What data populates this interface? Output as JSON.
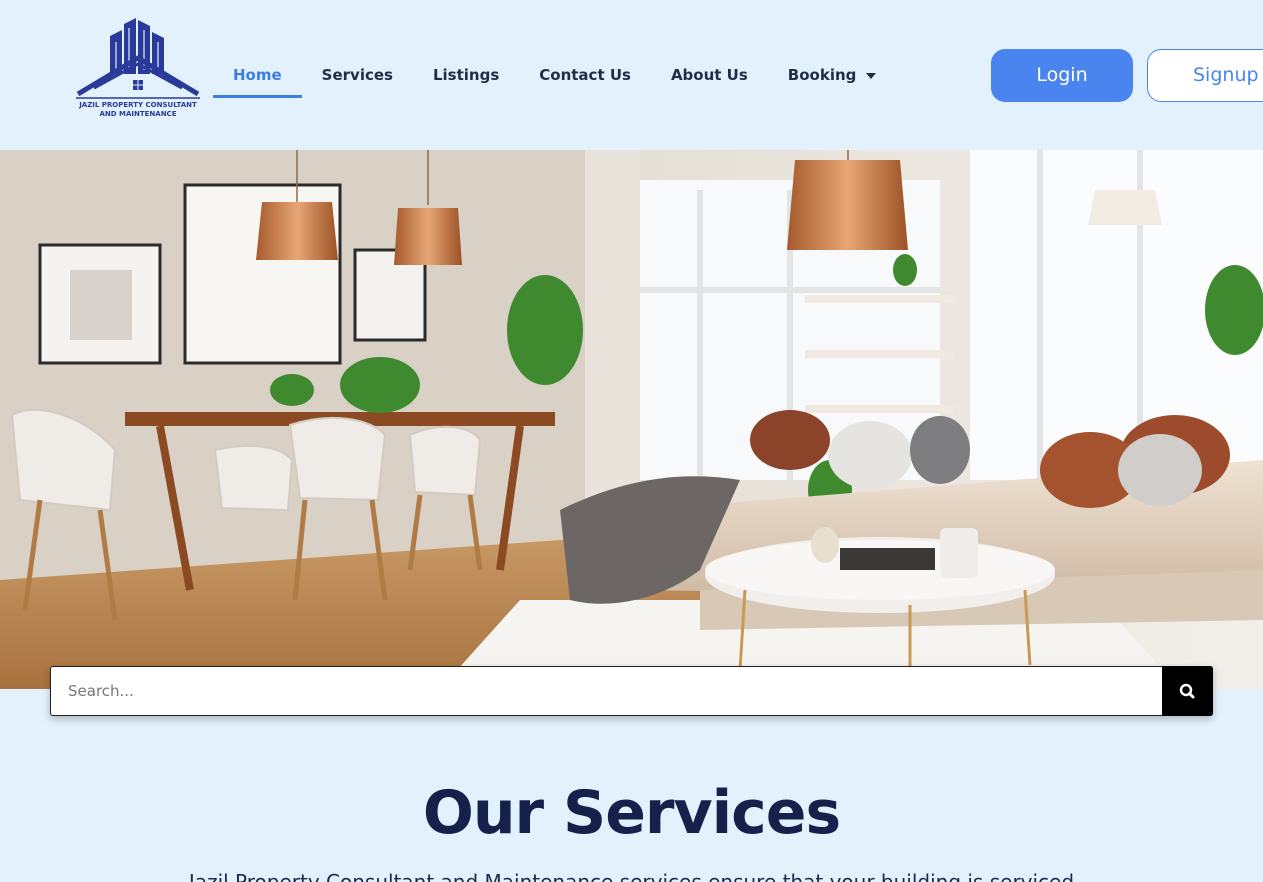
{
  "logo": {
    "text_line1": "JAZIL PROPERTY CONSULTANT",
    "text_line2": "AND MAINTENANCE"
  },
  "nav": {
    "items": [
      {
        "label": "Home",
        "active": true
      },
      {
        "label": "Services"
      },
      {
        "label": "Listings"
      },
      {
        "label": "Contact Us"
      },
      {
        "label": "About Us"
      },
      {
        "label": "Booking",
        "has_dropdown": true
      }
    ]
  },
  "auth": {
    "login_label": "Login",
    "signup_label": "Signup"
  },
  "search": {
    "placeholder": "Search..."
  },
  "services": {
    "title": "Our Services",
    "description": "Jazil Property Consultant and Maintenance services ensure that your building is serviced"
  },
  "colors": {
    "background": "#e3f1fc",
    "accent": "#4a85ef",
    "title": "#15214a"
  }
}
